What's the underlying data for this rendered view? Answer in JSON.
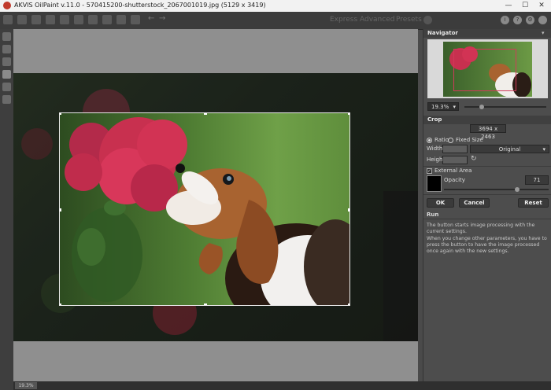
{
  "window": {
    "title": "AKVIS OilPaint v.11.0 - 570415200-shutterstock_2067001019.jpg (5129 x 3419)",
    "minimize": "—",
    "maximize": "☐",
    "close": "✕"
  },
  "toolbar": {
    "modes": [
      "Express",
      "Advanced",
      "Presets"
    ],
    "undo_icon": "undo-arrow-icon",
    "redo_icon": "redo-arrow-icon"
  },
  "navigator": {
    "title": "Navigator",
    "zoom": "19.3%"
  },
  "crop": {
    "title": "Crop",
    "size": "3694 x 2463",
    "ratio_label": "Ratio",
    "fixed_size_label": "Fixed Size",
    "width_label": "Width",
    "height_label": "Height",
    "ratio_value": "Original",
    "external_area_label": "External Area",
    "opacity_label": "Opacity",
    "opacity_value": "71",
    "ok_label": "OK",
    "cancel_label": "Cancel",
    "reset_label": "Reset"
  },
  "run": {
    "title": "Run",
    "desc1": "The button starts image processing with the current settings.",
    "desc2": "When you change other parameters, you have to press the button to have the image processed once again with the new settings."
  },
  "status": {
    "zoom": "19.3%"
  },
  "colors": {
    "accent": "#c0392b",
    "panel_bg": "#4d4d4d"
  }
}
